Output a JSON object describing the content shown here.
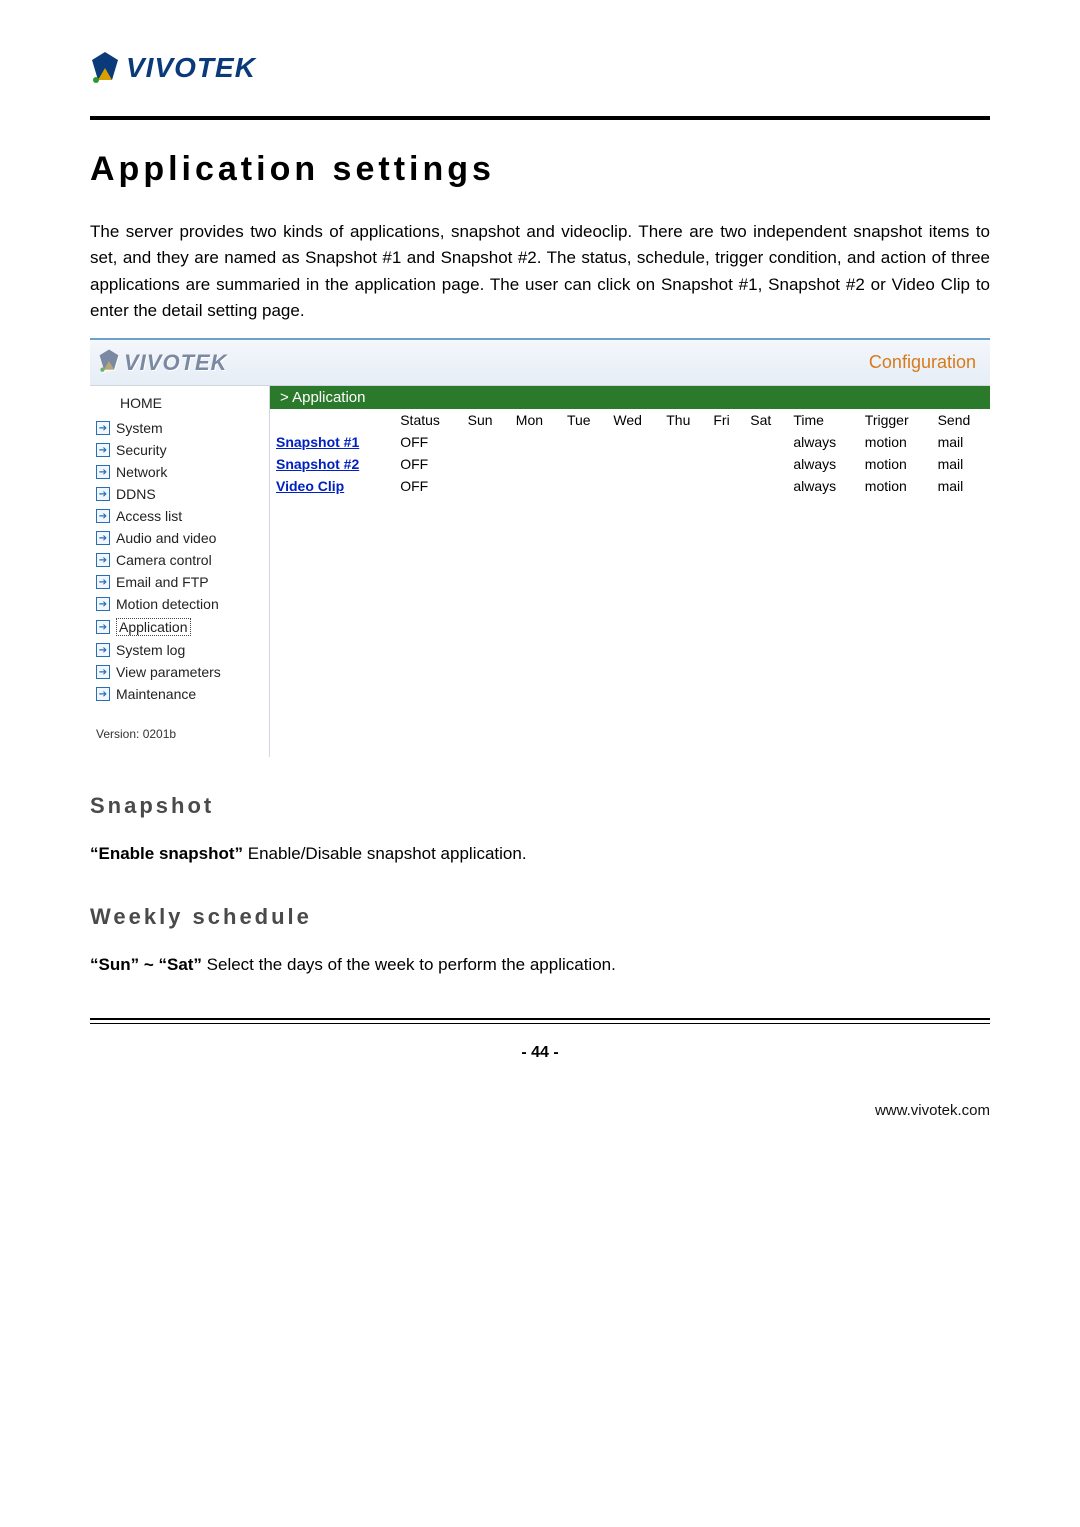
{
  "logo": {
    "text": "VIVOTEK"
  },
  "page_title": "Application settings",
  "intro_paragraph": "The server provides two kinds of applications, snapshot and videoclip. There are two independent snapshot items to set, and they are named as Snapshot #1 and Snapshot #2. The status, schedule, trigger condition, and action of three applications are summaried in the application page. The user can click on Snapshot #1, Snapshot #2 or Video Clip to enter the detail setting page.",
  "config_shot": {
    "logo_text": "VIVOTEK",
    "config_label": "Configuration",
    "sidebar": {
      "home_label": "HOME",
      "items": [
        {
          "label": "System"
        },
        {
          "label": "Security"
        },
        {
          "label": "Network"
        },
        {
          "label": "DDNS"
        },
        {
          "label": "Access list"
        },
        {
          "label": "Audio and video"
        },
        {
          "label": "Camera control"
        },
        {
          "label": "Email and FTP"
        },
        {
          "label": "Motion detection"
        },
        {
          "label": "Application"
        },
        {
          "label": "System log"
        },
        {
          "label": "View parameters"
        },
        {
          "label": "Maintenance"
        }
      ],
      "version": "Version: 0201b"
    },
    "breadcrumb": "> Application",
    "table": {
      "headers": [
        "",
        "Status",
        "Sun",
        "Mon",
        "Tue",
        "Wed",
        "Thu",
        "Fri",
        "Sat",
        "Time",
        "Trigger",
        "Send"
      ],
      "rows": [
        {
          "name": "Snapshot #1",
          "status": "OFF",
          "sun": "",
          "mon": "",
          "tue": "",
          "wed": "",
          "thu": "",
          "fri": "",
          "sat": "",
          "time": "always",
          "trigger": "motion",
          "send": "mail"
        },
        {
          "name": "Snapshot #2",
          "status": "OFF",
          "sun": "",
          "mon": "",
          "tue": "",
          "wed": "",
          "thu": "",
          "fri": "",
          "sat": "",
          "time": "always",
          "trigger": "motion",
          "send": "mail"
        },
        {
          "name": "Video Clip",
          "status": "OFF",
          "sun": "",
          "mon": "",
          "tue": "",
          "wed": "",
          "thu": "",
          "fri": "",
          "sat": "",
          "time": "always",
          "trigger": "motion",
          "send": "mail"
        }
      ]
    }
  },
  "sections": {
    "snapshot": {
      "heading": "Snapshot",
      "line_label": "“Enable snapshot”",
      "line_text": " Enable/Disable snapshot application."
    },
    "weekly": {
      "heading": "Weekly schedule",
      "line_label": "“Sun” ~ “Sat”",
      "line_text": " Select the days of the week to perform the application."
    }
  },
  "page_number": "- 44 -",
  "footer_url": "www.vivotek.com"
}
